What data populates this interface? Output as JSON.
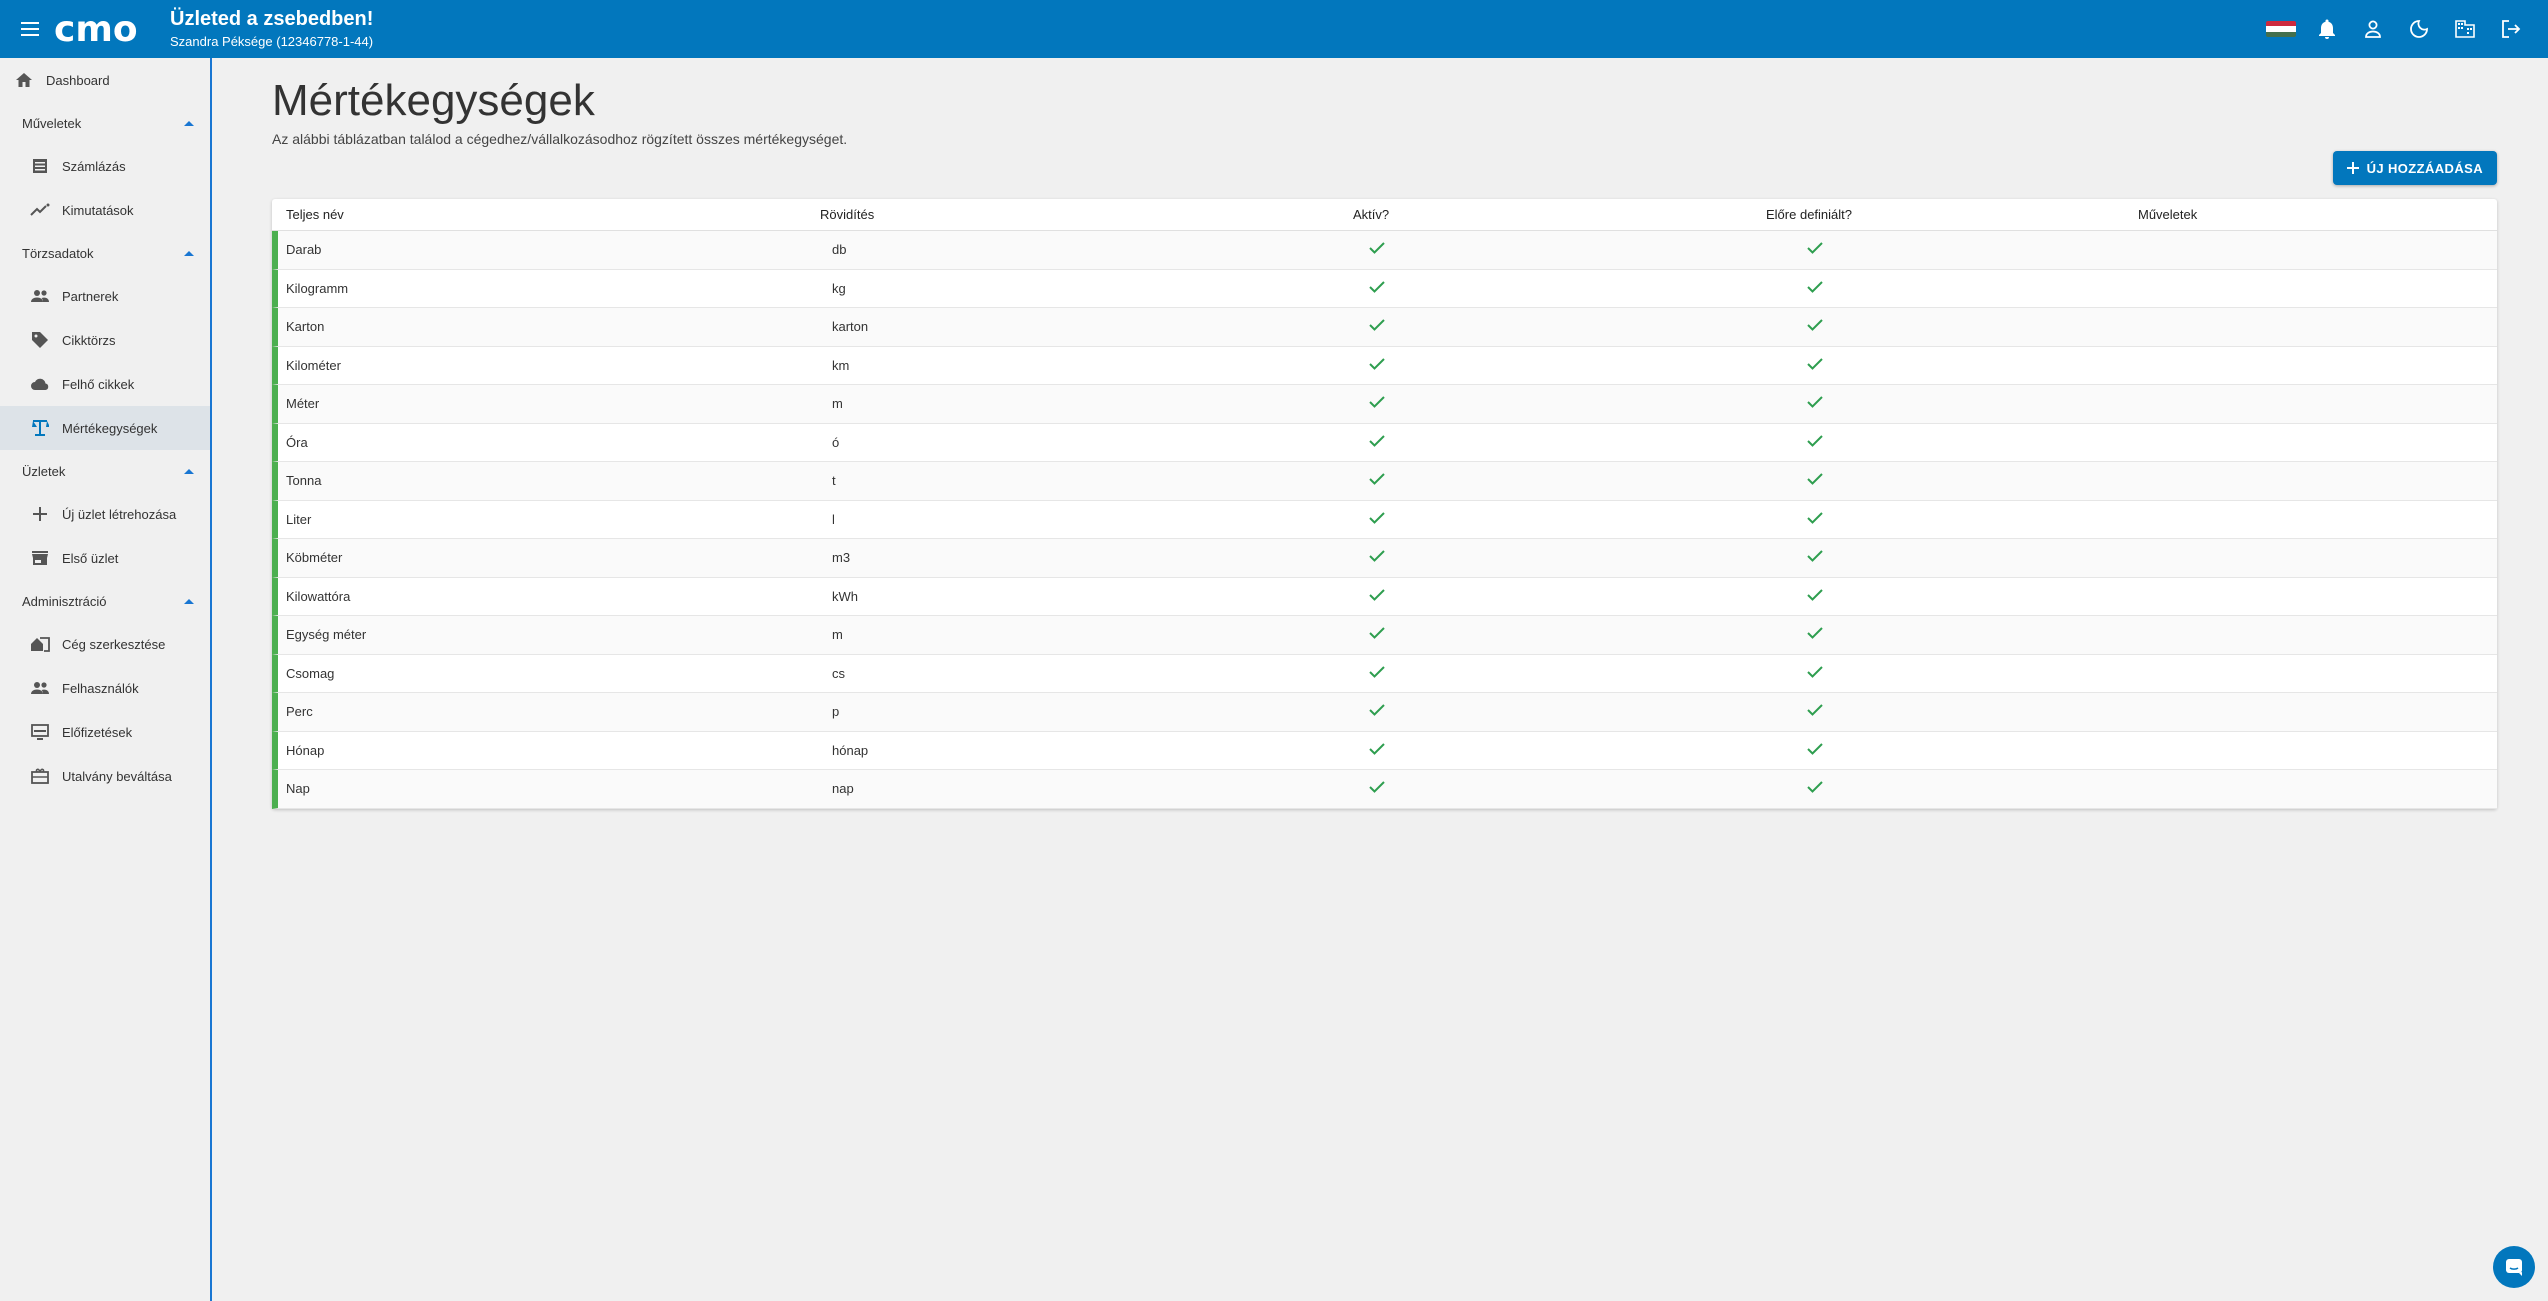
{
  "header": {
    "logo_text": "cmo",
    "title": "Üzleted a zsebedben!",
    "company": "Szandra Péksége (12346778-1-44)",
    "icons": [
      "menu-icon",
      "flag-hu-icon",
      "bell-icon",
      "person-icon",
      "moon-icon",
      "building-icon",
      "logout-icon"
    ]
  },
  "sidebar": {
    "dashboard": "Dashboard",
    "sections": [
      {
        "label": "Műveletek",
        "items": [
          "Számlázás",
          "Kimutatások"
        ]
      },
      {
        "label": "Törzsadatok",
        "items": [
          "Partnerek",
          "Cikktörzs",
          "Felhő cikkek",
          "Mértékegységek"
        ]
      },
      {
        "label": "Üzletek",
        "items": [
          "Új üzlet létrehozása",
          "Első üzlet"
        ]
      },
      {
        "label": "Adminisztráció",
        "items": [
          "Cég szerkesztése",
          "Felhasználók",
          "Előfizetések",
          "Utalvány beváltása"
        ]
      }
    ],
    "active_item": "Mértékegységek"
  },
  "main": {
    "title": "Mértékegységek",
    "description": "Az alábbi táblázatban találod a cégedhez/vállalkozásodhoz rögzített összes mértékegységet.",
    "add_button": "ÚJ HOZZÁADÁSA",
    "columns": [
      "Teljes név",
      "Rövidítés",
      "Aktív?",
      "Előre definiált?",
      "Műveletek"
    ],
    "rows": [
      {
        "name": "Darab",
        "abbr": "db"
      },
      {
        "name": "Kilogramm",
        "abbr": "kg"
      },
      {
        "name": "Karton",
        "abbr": "karton"
      },
      {
        "name": "Kilométer",
        "abbr": "km"
      },
      {
        "name": "Méter",
        "abbr": "m"
      },
      {
        "name": "Óra",
        "abbr": "ó"
      },
      {
        "name": "Tonna",
        "abbr": "t"
      },
      {
        "name": "Liter",
        "abbr": "l"
      },
      {
        "name": "Köbméter",
        "abbr": "m3"
      },
      {
        "name": "Kilowattóra",
        "abbr": "kWh"
      },
      {
        "name": "Egység méter",
        "abbr": "m"
      },
      {
        "name": "Csomag",
        "abbr": "cs"
      },
      {
        "name": "Perc",
        "abbr": "p"
      },
      {
        "name": "Hónap",
        "abbr": "hónap"
      },
      {
        "name": "Nap",
        "abbr": "nap"
      }
    ]
  },
  "colors": {
    "primary": "#0277bd",
    "row_accent": "#4caf50",
    "check": "#2e9e4f"
  }
}
